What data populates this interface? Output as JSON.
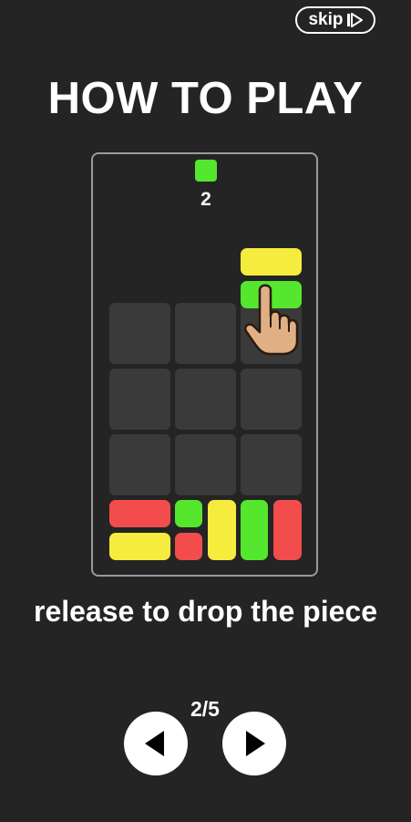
{
  "header": {
    "skip_label": "skip",
    "skip_icon": "skip-forward-icon"
  },
  "title": "HOW TO PLAY",
  "game": {
    "next_piece_color": "#55e62e",
    "next_piece_count": "2",
    "grid": {
      "columns": 3,
      "rows": 3
    },
    "colors": {
      "red": "#f24c4c",
      "yellow": "#f5ec3e",
      "green": "#55e62e",
      "empty_cell": "#3a3a3a"
    },
    "held_piece": [
      "yellow",
      "green"
    ],
    "pointer_icon": "hand-pointer-icon"
  },
  "instruction": "release to drop the piece",
  "pagination": {
    "current": "2/5",
    "prev_icon": "triangle-left-icon",
    "next_icon": "triangle-right-icon"
  }
}
